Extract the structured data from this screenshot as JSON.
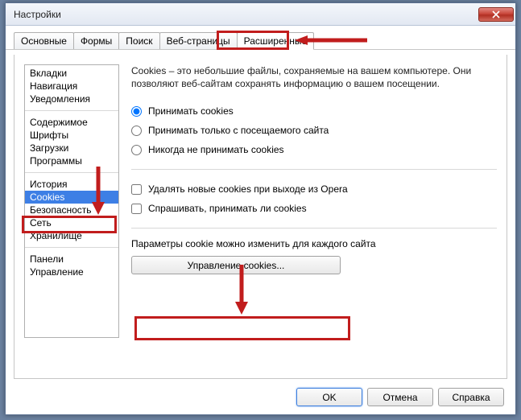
{
  "window": {
    "title": "Настройки"
  },
  "tabs": [
    {
      "label": "Основные"
    },
    {
      "label": "Формы"
    },
    {
      "label": "Поиск"
    },
    {
      "label": "Веб-страницы"
    },
    {
      "label": "Расширенные",
      "active": true
    }
  ],
  "sidebar": {
    "groups": [
      [
        "Вкладки",
        "Навигация",
        "Уведомления"
      ],
      [
        "Содержимое",
        "Шрифты",
        "Загрузки",
        "Программы"
      ],
      [
        "История",
        "Cookies",
        "Безопасность",
        "Сеть",
        "Хранилище"
      ],
      [
        "Панели",
        "Управление"
      ]
    ],
    "selected": "Cookies"
  },
  "main": {
    "description": "Cookies – это небольшие файлы, сохраняемые на вашем компьютере. Они позволяют веб-сайтам сохранять информацию о вашем посещении.",
    "radios": [
      {
        "label": "Принимать cookies",
        "checked": true
      },
      {
        "label": "Принимать только с посещаемого сайта",
        "checked": false
      },
      {
        "label": "Никогда не принимать cookies",
        "checked": false
      }
    ],
    "checks": [
      {
        "label": "Удалять новые cookies при выходе из Opera",
        "checked": false
      },
      {
        "label": "Спрашивать, принимать ли cookies",
        "checked": false
      }
    ],
    "per_site_label": "Параметры cookie можно изменить для каждого сайта",
    "manage_button": "Управление cookies..."
  },
  "footer": {
    "ok": "OK",
    "cancel": "Отмена",
    "help": "Справка"
  }
}
